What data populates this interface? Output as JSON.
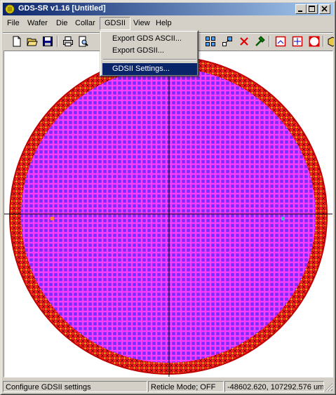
{
  "window": {
    "title": "GDS-SR v1.16 [Untitled]",
    "controls": [
      "minimize-icon",
      "maximize-icon",
      "close-icon"
    ]
  },
  "menubar": {
    "items": [
      {
        "label": "File"
      },
      {
        "label": "Wafer"
      },
      {
        "label": "Die"
      },
      {
        "label": "Collar"
      },
      {
        "label": "GDSII",
        "active": true
      },
      {
        "label": "View"
      },
      {
        "label": "Help"
      }
    ]
  },
  "dropdown": {
    "items": [
      {
        "label": "Export GDS ASCII...",
        "highlighted": false
      },
      {
        "label": "Export GDSII...",
        "highlighted": false
      },
      {
        "label": "GDSII Settings...",
        "highlighted": true
      }
    ]
  },
  "toolbar": {
    "icons": [
      "new-file-icon",
      "open-folder-icon",
      "save-icon",
      "print-icon",
      "print-preview-icon",
      "grid-icon",
      "resize-icon",
      "delete-icon",
      "hammer-icon",
      "reticle-icon",
      "move-center-icon",
      "circle-icon",
      "package-icon"
    ]
  },
  "wafer": {
    "die_fill": "#7b2cff",
    "die_grid_line": "#ff3dff",
    "edge_die_fill": "#ff2020",
    "edge_accent": "#e8e800",
    "marker_left": "#ff8040",
    "marker_right": "#40c0c0"
  },
  "statusbar": {
    "message": "Configure GDSII settings",
    "reticle_mode": "Reticle Mode; OFF",
    "coordinates": "-48602.620, 107292.576 um"
  }
}
